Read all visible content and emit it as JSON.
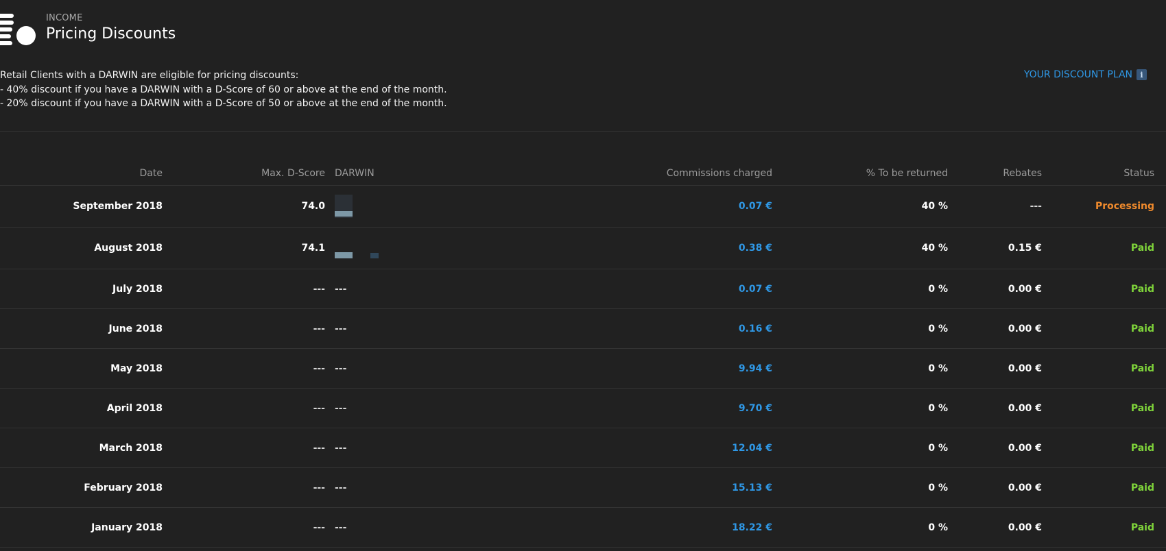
{
  "header": {
    "eyebrow": "INCOME",
    "title": "Pricing Discounts",
    "icon": "coins-icon"
  },
  "intro": {
    "line1": "Retail Clients with a DARWIN are eligible for pricing discounts:",
    "line2": "- 40% discount if you have a DARWIN with a D-Score of 60 or above at the end of the month.",
    "line3": "- 20% discount if you have a DARWIN with a D-Score of 50 or above at the end of the month."
  },
  "plan_link": {
    "label": "YOUR DISCOUNT PLAN",
    "icon": "info-icon",
    "icon_glyph": "i"
  },
  "table": {
    "columns": {
      "date": "Date",
      "dscore": "Max. D-Score",
      "darwin": "DARWIN",
      "commissions": "Commissions charged",
      "returned": "% To be returned",
      "rebates": "Rebates",
      "status": "Status"
    },
    "rows": [
      {
        "date": "September 2018",
        "dscore": "74.0",
        "darwin": "",
        "commissions": "0.07 €",
        "returned": "40 %",
        "rebates": "---",
        "status": "Processing"
      },
      {
        "date": "August 2018",
        "dscore": "74.1",
        "darwin": "",
        "commissions": "0.38 €",
        "returned": "40 %",
        "rebates": "0.15 €",
        "status": "Paid"
      },
      {
        "date": "July 2018",
        "dscore": "---",
        "darwin": "---",
        "commissions": "0.07 €",
        "returned": "0 %",
        "rebates": "0.00 €",
        "status": "Paid"
      },
      {
        "date": "June 2018",
        "dscore": "---",
        "darwin": "---",
        "commissions": "0.16 €",
        "returned": "0 %",
        "rebates": "0.00 €",
        "status": "Paid"
      },
      {
        "date": "May 2018",
        "dscore": "---",
        "darwin": "---",
        "commissions": "9.94 €",
        "returned": "0 %",
        "rebates": "0.00 €",
        "status": "Paid"
      },
      {
        "date": "April 2018",
        "dscore": "---",
        "darwin": "---",
        "commissions": "9.70 €",
        "returned": "0 %",
        "rebates": "0.00 €",
        "status": "Paid"
      },
      {
        "date": "March 2018",
        "dscore": "---",
        "darwin": "---",
        "commissions": "12.04 €",
        "returned": "0 %",
        "rebates": "0.00 €",
        "status": "Paid"
      },
      {
        "date": "February 2018",
        "dscore": "---",
        "darwin": "---",
        "commissions": "15.13 €",
        "returned": "0 %",
        "rebates": "0.00 €",
        "status": "Paid"
      },
      {
        "date": "January 2018",
        "dscore": "---",
        "darwin": "---",
        "commissions": "18.22 €",
        "returned": "0 %",
        "rebates": "0.00 €",
        "status": "Paid"
      }
    ]
  },
  "colors": {
    "background": "#212121",
    "link_blue": "#2f98e6",
    "processing_orange": "#f08a2c",
    "paid_green": "#7fd43a"
  }
}
